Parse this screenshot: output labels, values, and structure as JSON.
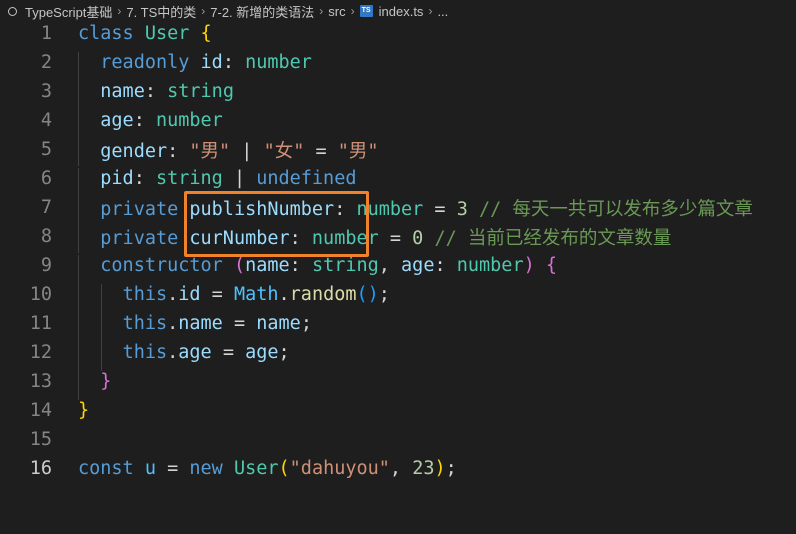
{
  "breadcrumb": {
    "items": [
      "TypeScript基础",
      "7. TS中的类",
      "7-2. 新增的类语法",
      "src",
      "index.ts",
      "..."
    ],
    "file_badge": "TS"
  },
  "editor": {
    "active_line": 16,
    "lines": [
      {
        "num": "1",
        "tokens": {
          "a": "class",
          "b": "User",
          "c": "{"
        }
      },
      {
        "num": "2",
        "tokens": {
          "a": "readonly",
          "b": "id",
          "c": "number"
        }
      },
      {
        "num": "3",
        "tokens": {
          "a": "name",
          "b": "string"
        }
      },
      {
        "num": "4",
        "tokens": {
          "a": "age",
          "b": "number"
        }
      },
      {
        "num": "5",
        "tokens": {
          "a": "gender",
          "b": "\"男\"",
          "c": "\"女\"",
          "d": "\"男\""
        }
      },
      {
        "num": "6",
        "tokens": {
          "a": "pid",
          "b": "string",
          "c": "undefined"
        }
      },
      {
        "num": "7",
        "tokens": {
          "a": "private",
          "b": "publishNumber",
          "c": "number",
          "d": "3",
          "e": "// 每天一共可以发布多少篇文章"
        }
      },
      {
        "num": "8",
        "tokens": {
          "a": "private",
          "b": "curNumber",
          "c": "number",
          "d": "0",
          "e": "// 当前已经发布的文章数量"
        }
      },
      {
        "num": "9",
        "tokens": {
          "a": "constructor",
          "b": "(",
          "c": "name",
          "d": "string",
          "e": "age",
          "f": "number",
          "g": ")",
          "h": "{"
        }
      },
      {
        "num": "10",
        "tokens": {
          "a": "this",
          "b": "id",
          "c": "Math",
          "d": "random",
          "e": "()"
        }
      },
      {
        "num": "11",
        "tokens": {
          "a": "this",
          "b": "name",
          "c": "name"
        }
      },
      {
        "num": "12",
        "tokens": {
          "a": "this",
          "b": "age",
          "c": "age"
        }
      },
      {
        "num": "13",
        "tokens": {
          "a": "}"
        }
      },
      {
        "num": "14",
        "tokens": {
          "a": "}"
        }
      },
      {
        "num": "15",
        "tokens": {}
      },
      {
        "num": "16",
        "tokens": {
          "a": "const",
          "b": "u",
          "c": "new",
          "d": "User",
          "e": "(",
          "f": "\"dahuyou\"",
          "g": "23",
          "h": ")"
        }
      }
    ]
  },
  "colors": {
    "background": "#1e1e1e",
    "highlight_box": "#f0822b"
  }
}
